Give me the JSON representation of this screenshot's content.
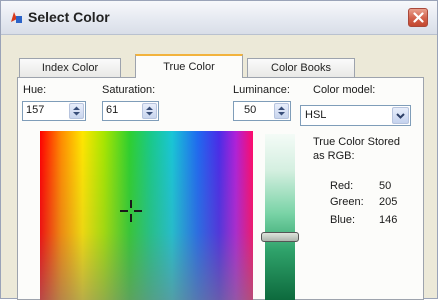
{
  "window": {
    "title": "Select Color"
  },
  "tabs": [
    {
      "label": "Index Color",
      "active": false
    },
    {
      "label": "True Color",
      "active": true
    },
    {
      "label": "Color Books",
      "active": false
    }
  ],
  "controls": {
    "hue": {
      "label": "Hue:",
      "value": "157"
    },
    "saturation": {
      "label": "Saturation:",
      "value": "61"
    },
    "luminance": {
      "label": "Luminance:",
      "value": "50"
    },
    "color_model": {
      "label": "Color model:",
      "value": "HSL"
    }
  },
  "rgb": {
    "caption_line1": "True Color Stored",
    "caption_line2": "as RGB:",
    "red_label": "Red:",
    "red_value": "50",
    "green_label": "Green:",
    "green_value": "205",
    "blue_label": "Blue:",
    "blue_value": "146"
  },
  "colors": {
    "selected": "#32cd92",
    "active_tab_accent": "#f2b33d",
    "close_button": "#d2604a"
  },
  "icons": {
    "app": "app-icon",
    "close": "close-icon",
    "spin": "spin-arrows-icon",
    "dropdown": "chevron-down-icon",
    "crosshair": "crosshair-icon"
  }
}
